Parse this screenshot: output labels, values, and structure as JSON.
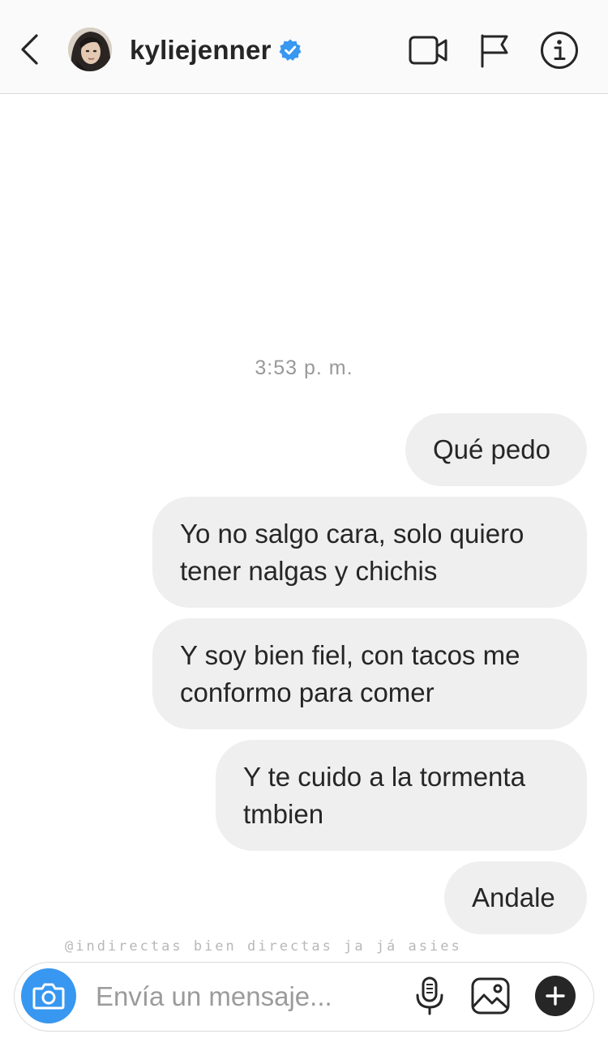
{
  "header": {
    "username": "kyliejenner",
    "verified": true,
    "icons": {
      "back": "chevron-left-icon",
      "video": "video-camera-icon",
      "flag": "flag-icon",
      "info": "info-icon"
    }
  },
  "thread": {
    "timestamp": "3:53 p. m.",
    "messages": [
      {
        "text": "Qué pedo"
      },
      {
        "text": "Yo no salgo cara, solo quiero\ntener nalgas y chichis"
      },
      {
        "text": "Y soy bien fiel, con tacos me\nconformo para comer"
      },
      {
        "text": "Y te cuido a la tormenta\ntmbien"
      },
      {
        "text": "Andale"
      }
    ]
  },
  "watermark": "@indirectas bien directas ja já asies",
  "composer": {
    "placeholder": "Envía un mensaje...",
    "value": ""
  },
  "colors": {
    "accent": "#3897f0",
    "bubble": "#efefef",
    "text": "#262626",
    "muted": "#999999"
  }
}
